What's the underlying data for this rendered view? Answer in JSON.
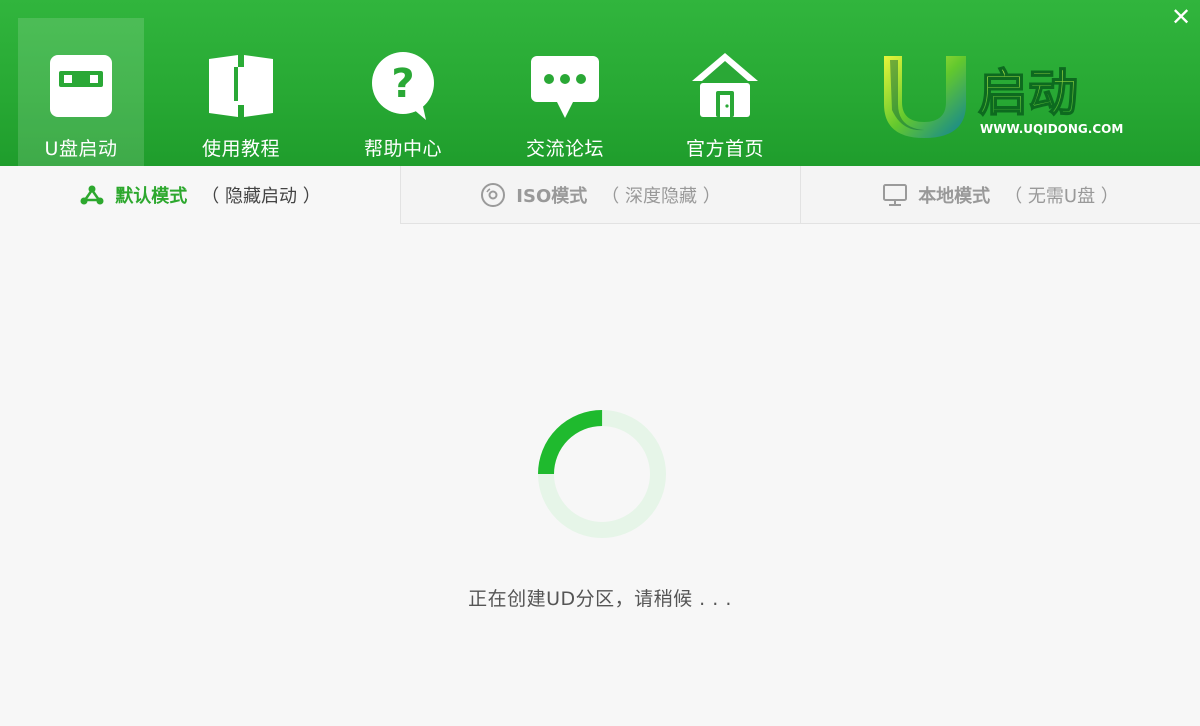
{
  "window": {
    "close_symbol": "✕"
  },
  "nav": {
    "items": [
      {
        "label": "U盘启动",
        "icon": "usb-drive-icon",
        "active": true
      },
      {
        "label": "使用教程",
        "icon": "book-icon",
        "active": false
      },
      {
        "label": "帮助中心",
        "icon": "help-bubble-icon",
        "active": false
      },
      {
        "label": "交流论坛",
        "icon": "chat-bubble-icon",
        "active": false
      },
      {
        "label": "官方首页",
        "icon": "home-icon",
        "active": false
      }
    ]
  },
  "logo": {
    "main_text": "启动",
    "letter": "U",
    "url_text": "WWW.UQIDONG.COM"
  },
  "tabs": [
    {
      "title": "默认模式",
      "subtitle": "（ 隐藏启动 ）",
      "icon": "share-nodes-icon",
      "active": true
    },
    {
      "title": "ISO模式",
      "subtitle": "（ 深度隐藏 ）",
      "icon": "disc-icon",
      "active": false
    },
    {
      "title": "本地模式",
      "subtitle": "（ 无需U盘 ）",
      "icon": "monitor-icon",
      "active": false
    }
  ],
  "progress": {
    "status_text": "正在创建UD分区，请稍候 . . .",
    "spinner_fraction": 0.25,
    "accent_color": "#1fba2e",
    "track_color": "#e6f5e8"
  },
  "colors": {
    "header_green": "#27a833",
    "active_tab_text": "#2da82e"
  }
}
